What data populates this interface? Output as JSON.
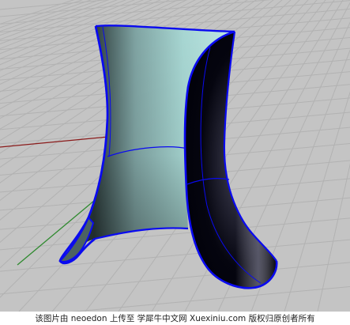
{
  "viewport": {
    "type": "perspective-3d-view",
    "background_color": "#c4c4c4",
    "grid_color": "#b2b2b2",
    "x_axis_color": "#8a1a1a",
    "y_axis_color": "#2f8a2f",
    "surface_edge_color": "#0a0af0",
    "grid_visible": true
  },
  "watermark": {
    "text": "该图片由 neoedon 上传至 学犀牛中文网 Xuexiniu.com 版权归原创者所有"
  }
}
